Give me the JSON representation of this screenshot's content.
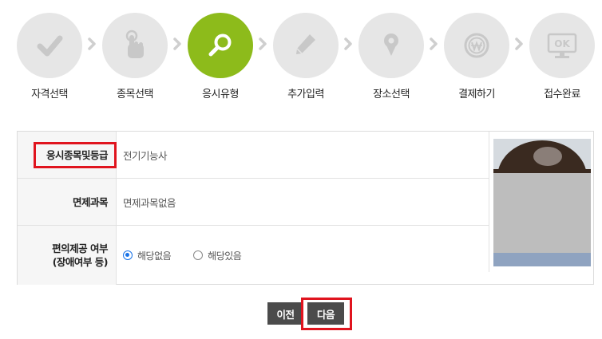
{
  "steps": [
    {
      "label": "자격선택",
      "icon": "check-icon"
    },
    {
      "label": "종목선택",
      "icon": "pointer-hand-icon"
    },
    {
      "label": "응시유형",
      "icon": "search-icon"
    },
    {
      "label": "추가입력",
      "icon": "pencil-icon"
    },
    {
      "label": "장소선택",
      "icon": "location-pin-icon"
    },
    {
      "label": "결제하기",
      "icon": "won-coin-icon"
    },
    {
      "label": "접수완료",
      "icon": "ok-monitor-icon"
    }
  ],
  "active_step_index": 2,
  "colors": {
    "active_step": "#8dbb1b",
    "inactive_step": "#e6e6e6",
    "highlight_box": "#e0141e",
    "button_bg": "#4b4b4b"
  },
  "form": {
    "exam_item_label": "응시종목및등급",
    "exam_item_value": "전기기능사",
    "exempt_label": "면제과목",
    "exempt_value": "면제과목없음",
    "accommodation_label_line1": "편의제공 여부",
    "accommodation_label_line2": "(장애여부 등)",
    "accommodation_options": [
      {
        "label": "해당없음",
        "selected": true
      },
      {
        "label": "해당있음",
        "selected": false
      }
    ]
  },
  "buttons": {
    "prev_label": "이전",
    "next_label": "다음"
  }
}
